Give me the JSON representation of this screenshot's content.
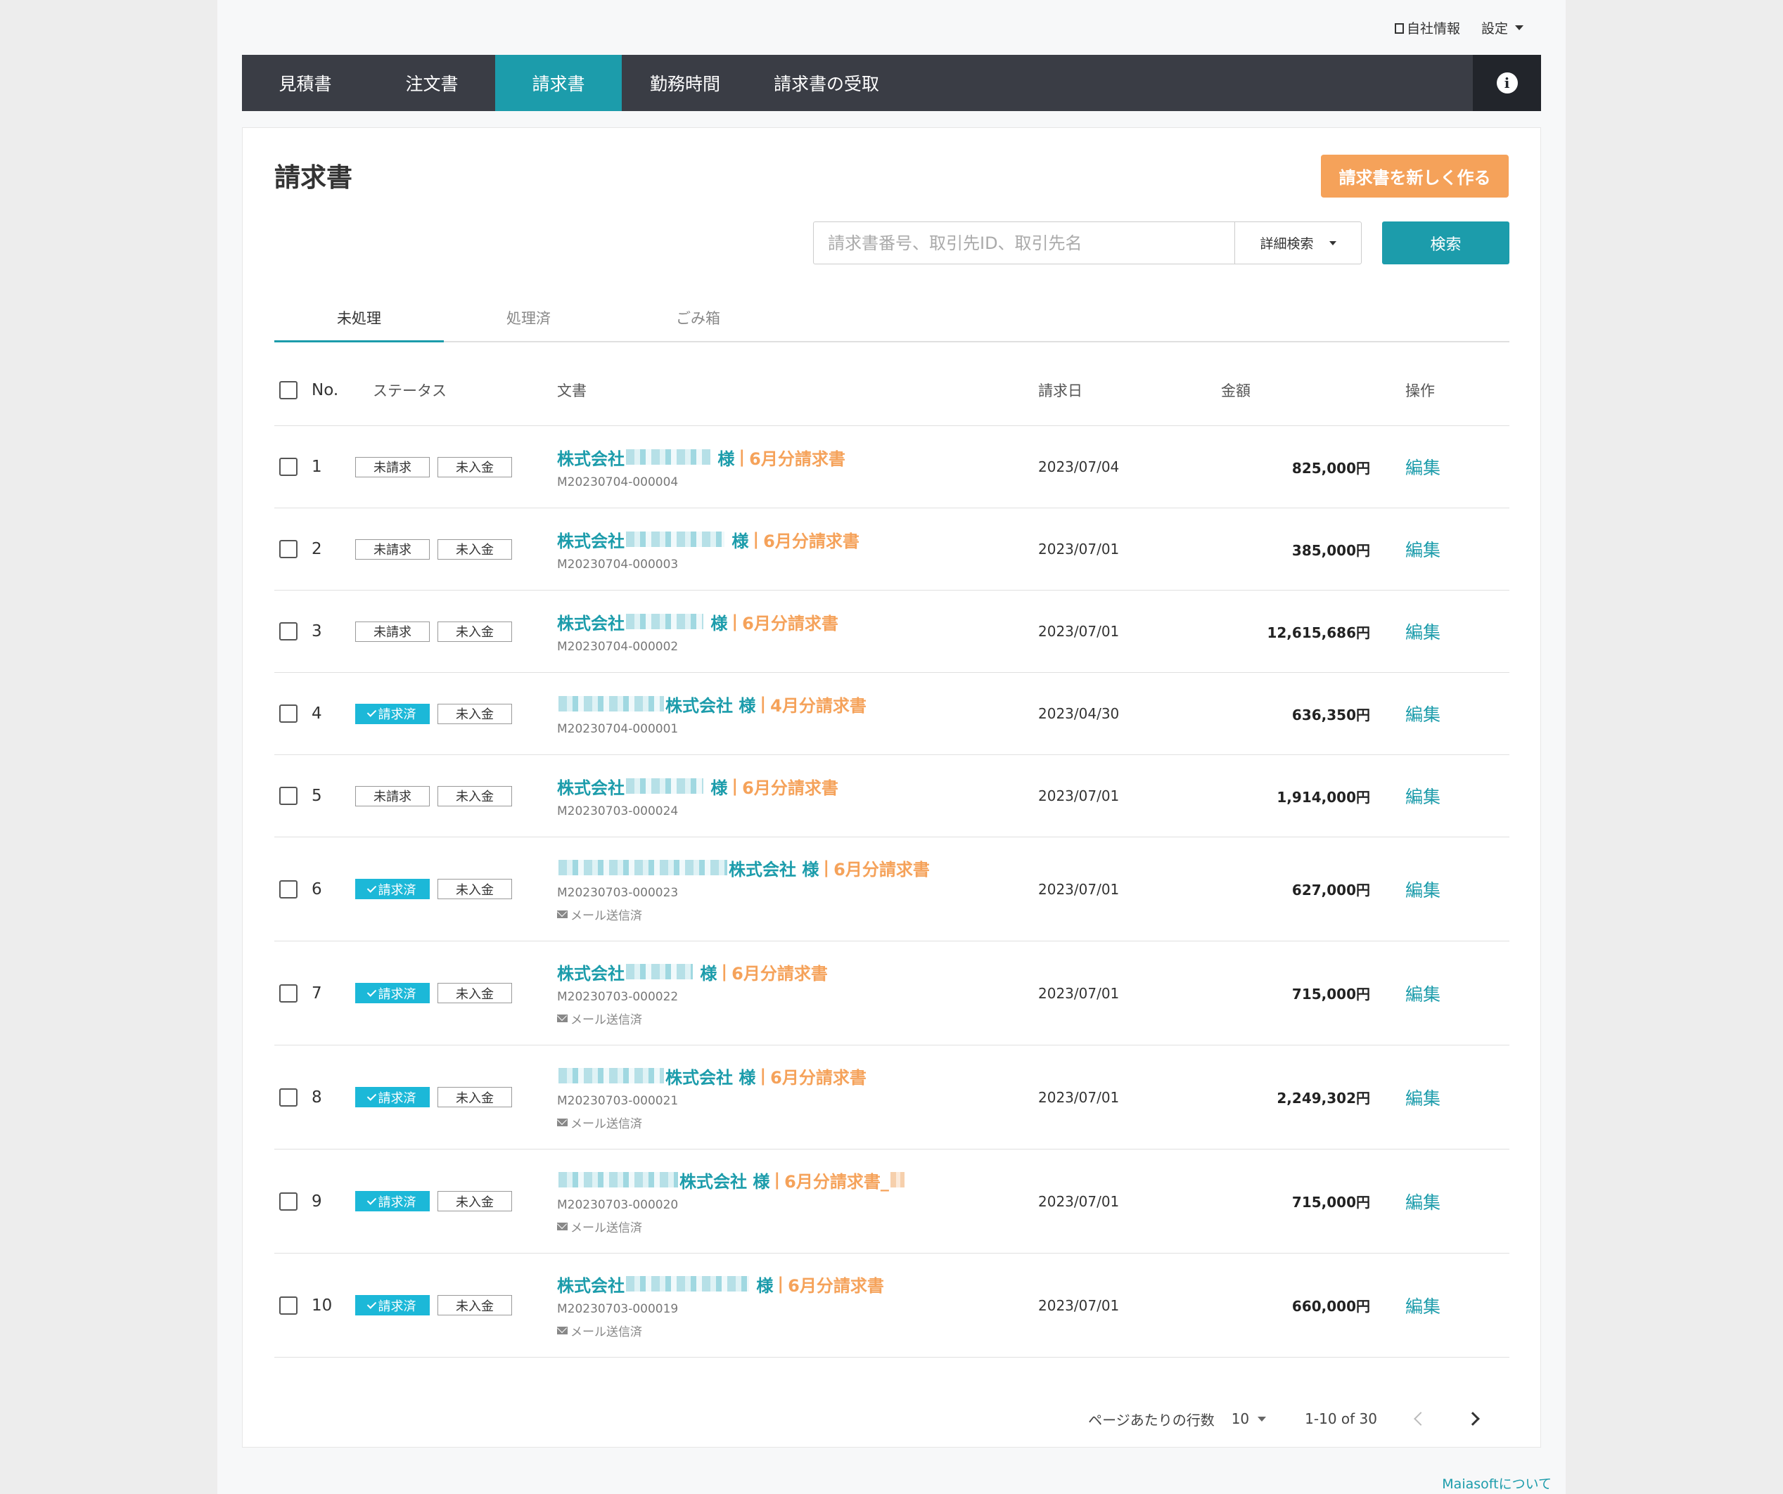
{
  "topbar": {
    "company_info": "自社情報",
    "settings": "設定"
  },
  "nav": {
    "items": [
      {
        "label": "見積書"
      },
      {
        "label": "注文書"
      },
      {
        "label": "請求書"
      },
      {
        "label": "勤務時間"
      },
      {
        "label": "請求書の受取"
      }
    ],
    "active_index": 2
  },
  "main": {
    "title": "請求書",
    "new_button": "請求書を新しく作る",
    "search_placeholder": "請求書番号、取引先ID、取引先名",
    "search_value": "",
    "detail_search": "詳細検索",
    "search_button": "検索"
  },
  "tabs": [
    {
      "label": "未処理"
    },
    {
      "label": "処理済"
    },
    {
      "label": "ごみ箱"
    }
  ],
  "table": {
    "headers": {
      "no": "No.",
      "status": "ステータス",
      "document": "文書",
      "date": "請求日",
      "amount": "金額",
      "ops": "操作"
    },
    "rows": [
      {
        "no": "1",
        "billing": "未請求",
        "billed": false,
        "payment": "未入金",
        "company_pre": "株式会社",
        "company_post": "",
        "honorific": "様",
        "doc_name": "6月分請求書",
        "doc_id": "M20230704-000004",
        "mail": "",
        "date": "2023/07/04",
        "amount": "825,000円",
        "edit": "編集"
      },
      {
        "no": "2",
        "billing": "未請求",
        "billed": false,
        "payment": "未入金",
        "company_pre": "株式会社",
        "company_post": "",
        "honorific": "様",
        "doc_name": "6月分請求書",
        "doc_id": "M20230704-000003",
        "mail": "",
        "date": "2023/07/01",
        "amount": "385,000円",
        "edit": "編集"
      },
      {
        "no": "3",
        "billing": "未請求",
        "billed": false,
        "payment": "未入金",
        "company_pre": "株式会社",
        "company_post": "",
        "honorific": "様",
        "doc_name": "6月分請求書",
        "doc_id": "M20230704-000002",
        "mail": "",
        "date": "2023/07/01",
        "amount": "12,615,686円",
        "edit": "編集"
      },
      {
        "no": "4",
        "billing": "請求済",
        "billed": true,
        "payment": "未入金",
        "company_pre": "",
        "company_post": "株式会社",
        "honorific": "様",
        "doc_name": "4月分請求書",
        "doc_id": "M20230704-000001",
        "mail": "",
        "date": "2023/04/30",
        "amount": "636,350円",
        "edit": "編集"
      },
      {
        "no": "5",
        "billing": "未請求",
        "billed": false,
        "payment": "未入金",
        "company_pre": "株式会社",
        "company_post": "",
        "honorific": "様",
        "doc_name": "6月分請求書",
        "doc_id": "M20230703-000024",
        "mail": "",
        "date": "2023/07/01",
        "amount": "1,914,000円",
        "edit": "編集"
      },
      {
        "no": "6",
        "billing": "請求済",
        "billed": true,
        "payment": "未入金",
        "company_pre": "",
        "company_post": "株式会社",
        "honorific": "様",
        "doc_name": "6月分請求書",
        "doc_id": "M20230703-000023",
        "mail": "メール送信済",
        "date": "2023/07/01",
        "amount": "627,000円",
        "edit": "編集"
      },
      {
        "no": "7",
        "billing": "請求済",
        "billed": true,
        "payment": "未入金",
        "company_pre": "株式会社",
        "company_post": "",
        "honorific": "様",
        "doc_name": "6月分請求書",
        "doc_id": "M20230703-000022",
        "mail": "メール送信済",
        "date": "2023/07/01",
        "amount": "715,000円",
        "edit": "編集"
      },
      {
        "no": "8",
        "billing": "請求済",
        "billed": true,
        "payment": "未入金",
        "company_pre": "",
        "company_post": "株式会社",
        "honorific": "様",
        "doc_name": "6月分請求書",
        "doc_id": "M20230703-000021",
        "mail": "メール送信済",
        "date": "2023/07/01",
        "amount": "2,249,302円",
        "edit": "編集"
      },
      {
        "no": "9",
        "billing": "請求済",
        "billed": true,
        "payment": "未入金",
        "company_pre": "",
        "company_post": "株式会社",
        "honorific": "様",
        "doc_name": "6月分請求書_",
        "doc_id": "M20230703-000020",
        "mail": "メール送信済",
        "date": "2023/07/01",
        "amount": "715,000円",
        "edit": "編集"
      },
      {
        "no": "10",
        "billing": "請求済",
        "billed": true,
        "payment": "未入金",
        "company_pre": "株式会社",
        "company_post": "",
        "honorific": "様",
        "doc_name": "6月分請求書",
        "doc_id": "M20230703-000019",
        "mail": "メール送信済",
        "date": "2023/07/01",
        "amount": "660,000円",
        "edit": "編集"
      }
    ]
  },
  "pager": {
    "rows_label": "ページあたりの行数",
    "rows_value": "10",
    "range": "1-10 of 30"
  },
  "footer": {
    "about": "Maiasoftについて"
  },
  "colors": {
    "accent": "#1c9cab",
    "orange": "#f5a25a",
    "nav_bg": "#3a3d45",
    "billed_badge": "#1cb8d8"
  },
  "icons": {
    "company_info": "building-icon",
    "info": "info-icon",
    "mail": "mail-icon"
  }
}
